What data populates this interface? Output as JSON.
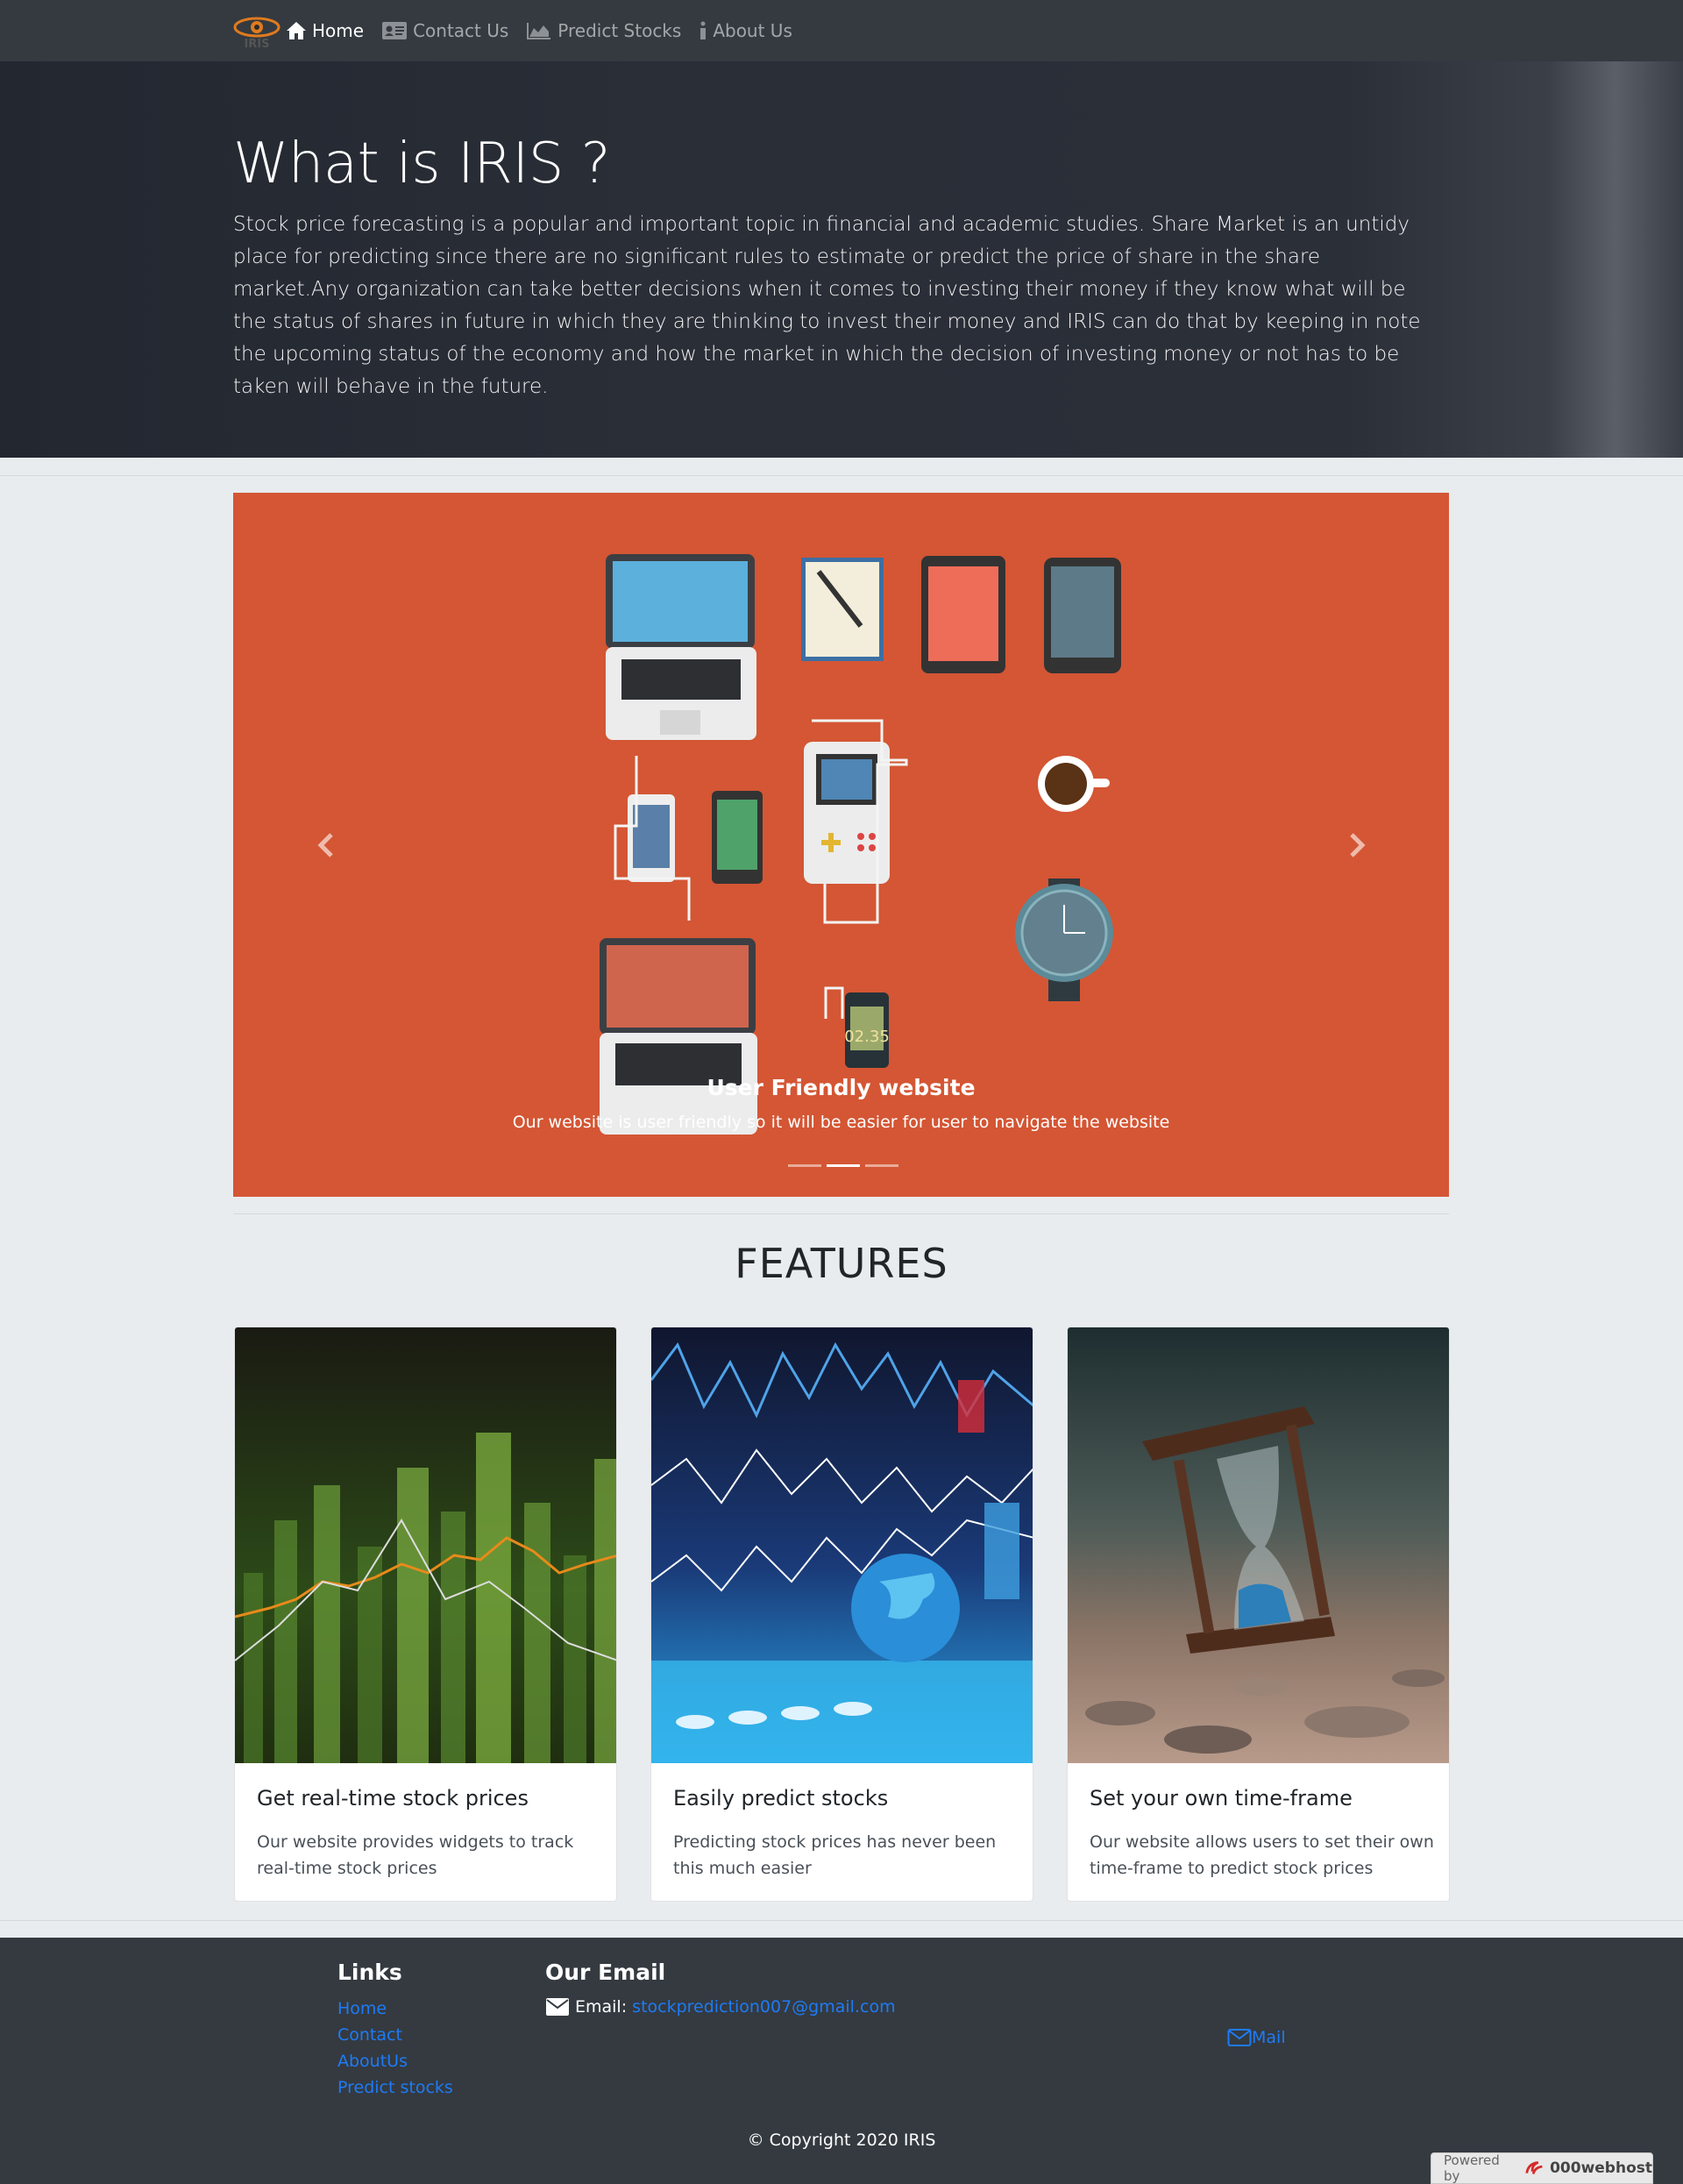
{
  "nav": {
    "brand_alt": "IRIS",
    "items": [
      {
        "label": "Home",
        "icon": "home-icon",
        "active": true
      },
      {
        "label": "Contact Us",
        "icon": "contact-card-icon"
      },
      {
        "label": "Predict Stocks",
        "icon": "area-chart-icon"
      },
      {
        "label": "About Us",
        "icon": "info-icon"
      }
    ]
  },
  "hero": {
    "title": "What is IRIS ?",
    "text": "Stock price forecasting is a popular and important topic in financial and academic studies. Share Market is an untidy place for predicting since there are no significant rules to estimate or predict the price of share in the share market.Any organization can take better decisions when it comes to investing their money if they know what will be the status of shares in future in which they are thinking to invest their money and IRIS can do that by keeping in note the upcoming status of the economy and how the market in which the decision of investing money or not has to be taken will behave in the future."
  },
  "carousel": {
    "caption_title": "User Friendly website",
    "caption_text": "Our website is user friendly so it will be easier for user to navigate the website",
    "watch_time": "02.35",
    "slide_count": 3,
    "active_slide": 2,
    "bg_color": "#d45634"
  },
  "features": {
    "title": "FEATURES",
    "cards": [
      {
        "title": "Get real-time stock prices",
        "text": "Our website provides widgets to track real-time stock prices"
      },
      {
        "title": "Easily predict stocks",
        "text": "Predicting stock prices has never been this much easier"
      },
      {
        "title": "Set your own time-frame",
        "text": "Our website allows users to set their own time-frame to predict stock prices"
      }
    ]
  },
  "footer": {
    "links_heading": "Links",
    "links": [
      "Home",
      "Contact",
      "AboutUs",
      "Predict stocks"
    ],
    "email_heading": "Our Email",
    "email_label": "Email:",
    "email": "stockprediction007@gmail.com",
    "mail_link": "Mail",
    "copyright": "© Copyright 2020 IRIS",
    "powered_by": "Powered by",
    "host": "000webhost"
  },
  "colors": {
    "navbar": "#343a40",
    "link": "#1e7bf6",
    "accent": "#d45634"
  }
}
